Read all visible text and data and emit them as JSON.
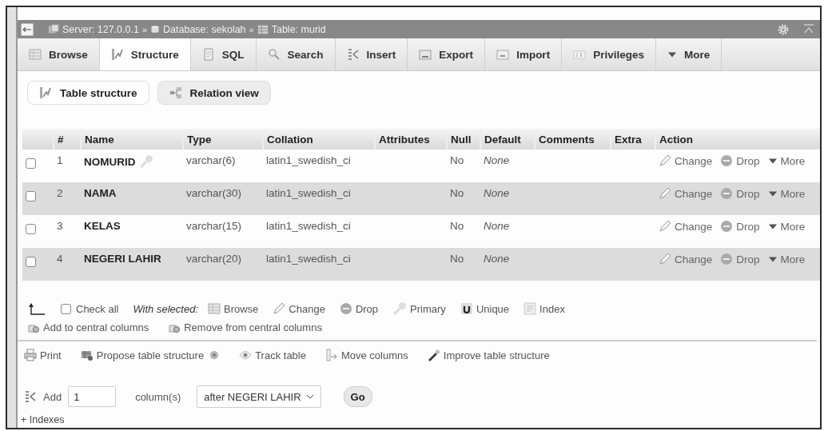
{
  "breadcrumb": {
    "separator": "»",
    "items": [
      "Server: 127.0.0.1",
      "Database: sekolah",
      "Table: murid"
    ]
  },
  "tabs": [
    {
      "label": "Browse",
      "selected": false
    },
    {
      "label": "Structure",
      "selected": true
    },
    {
      "label": "SQL",
      "selected": false
    },
    {
      "label": "Search",
      "selected": false
    },
    {
      "label": "Insert",
      "selected": false
    },
    {
      "label": "Export",
      "selected": false
    },
    {
      "label": "Import",
      "selected": false
    },
    {
      "label": "Privileges",
      "selected": false
    },
    {
      "label": "More",
      "selected": false
    }
  ],
  "subtabs": [
    {
      "label": "Table structure",
      "selected": true
    },
    {
      "label": "Relation view",
      "selected": false
    }
  ],
  "table": {
    "columns": [
      "#",
      "Name",
      "Type",
      "Collation",
      "Attributes",
      "Null",
      "Default",
      "Comments",
      "Extra",
      "Action"
    ],
    "rows": [
      {
        "checked": false,
        "number": "1",
        "name": "NOMURID",
        "primary": true,
        "type": "varchar(6)",
        "collation": "latin1_swedish_ci",
        "null": "No",
        "default": "None",
        "actions": [
          "Change",
          "Drop",
          "More"
        ]
      },
      {
        "checked": false,
        "number": "2",
        "name": "NAMA",
        "primary": false,
        "type": "varchar(30)",
        "collation": "latin1_swedish_ci",
        "null": "No",
        "default": "None",
        "actions": [
          "Change",
          "Drop",
          "More"
        ]
      },
      {
        "checked": false,
        "number": "3",
        "name": "KELAS",
        "primary": false,
        "type": "varchar(15)",
        "collation": "latin1_swedish_ci",
        "null": "No",
        "default": "None",
        "actions": [
          "Change",
          "Drop",
          "More"
        ]
      },
      {
        "checked": false,
        "number": "4",
        "name": "NEGERI LAHIR",
        "primary": false,
        "type": "varchar(20)",
        "collation": "latin1_swedish_ci",
        "null": "No",
        "default": "None",
        "actions": [
          "Change",
          "Drop",
          "More"
        ]
      }
    ]
  },
  "bulk": {
    "check_all": {
      "label": "Check all",
      "checked": false
    },
    "with_selected": "With selected:",
    "actions": [
      "Browse",
      "Change",
      "Drop",
      "Primary",
      "Unique",
      "Index"
    ],
    "central": [
      "Add to central columns",
      "Remove from central columns"
    ]
  },
  "tools": [
    "Print",
    "Propose table structure",
    "Track table",
    "Move columns",
    "Improve table structure"
  ],
  "add_column": {
    "label": "Add",
    "count": "1",
    "unit": "column(s)",
    "position": "after NEGERI LAHIR",
    "button": "Go"
  },
  "indexes_link": "+ Indexes"
}
